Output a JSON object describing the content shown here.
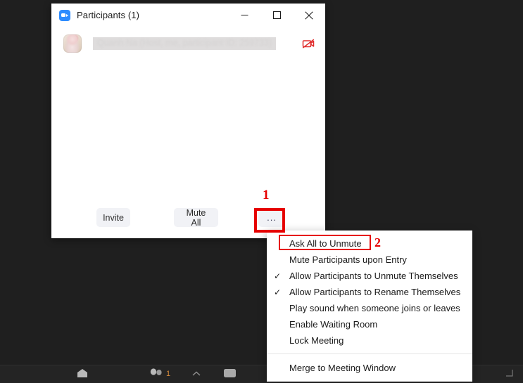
{
  "window": {
    "title": "Participants (1)",
    "app_icon": "zoom-video-icon",
    "controls": {
      "minimize": "minimize-icon",
      "maximize": "maximize-icon",
      "close": "close-icon"
    }
  },
  "participants": [
    {
      "name_redacted": "Quanh Na (Host, me, participant ID: 259733)",
      "avatar": "user-avatar",
      "video_status_icon": "video-off-icon"
    }
  ],
  "footer": {
    "invite_label": "Invite",
    "mute_all_label": "Mute All",
    "more_label": "..."
  },
  "context_menu": {
    "items": [
      {
        "label": "Ask All to Unmute",
        "checked": false
      },
      {
        "label": "Mute Participants upon Entry",
        "checked": false
      },
      {
        "label": "Allow Participants to Unmute Themselves",
        "checked": true
      },
      {
        "label": "Allow Participants to Rename Themselves",
        "checked": true
      },
      {
        "label": "Play sound when someone joins or leaves",
        "checked": false
      },
      {
        "label": "Enable Waiting Room",
        "checked": false
      },
      {
        "label": "Lock Meeting",
        "checked": false
      }
    ],
    "separator_after_index": 6,
    "footer_item": {
      "label": "Merge to Meeting Window",
      "checked": false
    },
    "check_glyph": "✓"
  },
  "annotations": [
    {
      "number": "1",
      "target": "more-options-button",
      "color": "#e60000"
    },
    {
      "number": "2",
      "target": "ask-all-to-unmute-menu-item",
      "color": "#e60000"
    }
  ],
  "meeting_toolbar": {
    "items": [
      {
        "icon": "home-icon",
        "label": ""
      },
      {
        "icon": "participants-icon",
        "label": "1"
      },
      {
        "icon": "chevron-up-icon",
        "label": ""
      },
      {
        "icon": "share-screen-icon",
        "label": ""
      },
      {
        "icon": "record-icon",
        "label": ""
      },
      {
        "icon": "reactions-chevron-icon",
        "label": ""
      },
      {
        "icon": "apps-grid-icon",
        "label": ""
      },
      {
        "icon": "more-icon",
        "label": ""
      },
      {
        "icon": "resize-handle-icon",
        "label": ""
      }
    ]
  },
  "colors": {
    "accent_blue": "#2d8cff",
    "annotation_red": "#e60000",
    "video_off_red": "#e02b2b",
    "desktop_bg": "#1f1f1f",
    "toolbar_bg": "#242424",
    "button_bg": "#f1f2f6"
  }
}
